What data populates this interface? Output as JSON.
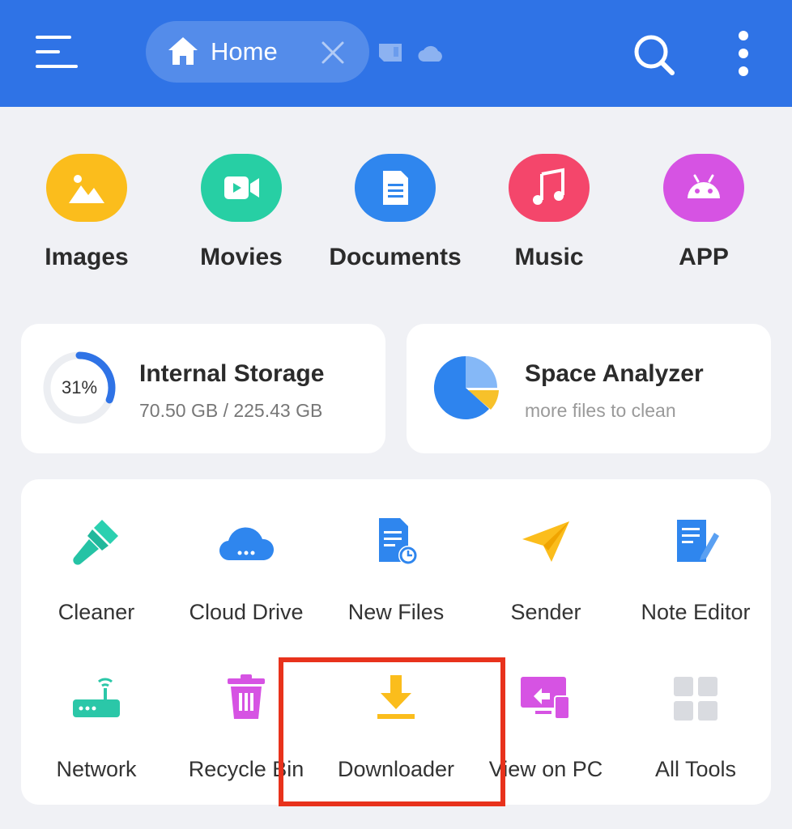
{
  "topbar": {
    "tab_label": "Home",
    "background": "#2f73e6",
    "icons": [
      "menu-icon",
      "home-icon",
      "close-icon",
      "sd-card-icon",
      "cloud-icon",
      "search-icon",
      "more-vertical-icon"
    ]
  },
  "categories": [
    {
      "label": "Images",
      "color": "#fbbd1c",
      "icon": "image-icon"
    },
    {
      "label": "Movies",
      "color": "#27cfa4",
      "icon": "video-icon"
    },
    {
      "label": "Documents",
      "color": "#2f86ee",
      "icon": "document-icon"
    },
    {
      "label": "Music",
      "color": "#f4466b",
      "icon": "music-icon"
    },
    {
      "label": "APP",
      "color": "#d653e3",
      "icon": "android-icon"
    }
  ],
  "storage": {
    "title": "Internal Storage",
    "percent": "31%",
    "percent_value": 31,
    "used": "70.50 GB / 225.43 GB"
  },
  "analyzer": {
    "title": "Space Analyzer",
    "subtitle": "more files to clean"
  },
  "tools": [
    {
      "label": "Cleaner",
      "icon": "brush-icon"
    },
    {
      "label": "Cloud Drive",
      "icon": "cloud-drive-icon"
    },
    {
      "label": "New Files",
      "icon": "new-files-icon"
    },
    {
      "label": "Sender",
      "icon": "paper-plane-icon"
    },
    {
      "label": "Note Editor",
      "icon": "note-edit-icon"
    },
    {
      "label": "Network",
      "icon": "router-icon"
    },
    {
      "label": "Recycle Bin",
      "icon": "trash-icon"
    },
    {
      "label": "Downloader",
      "icon": "download-icon"
    },
    {
      "label": "View on PC",
      "icon": "monitor-icon"
    },
    {
      "label": "All Tools",
      "icon": "grid-icon"
    }
  ],
  "highlight_color": "#e8321c"
}
